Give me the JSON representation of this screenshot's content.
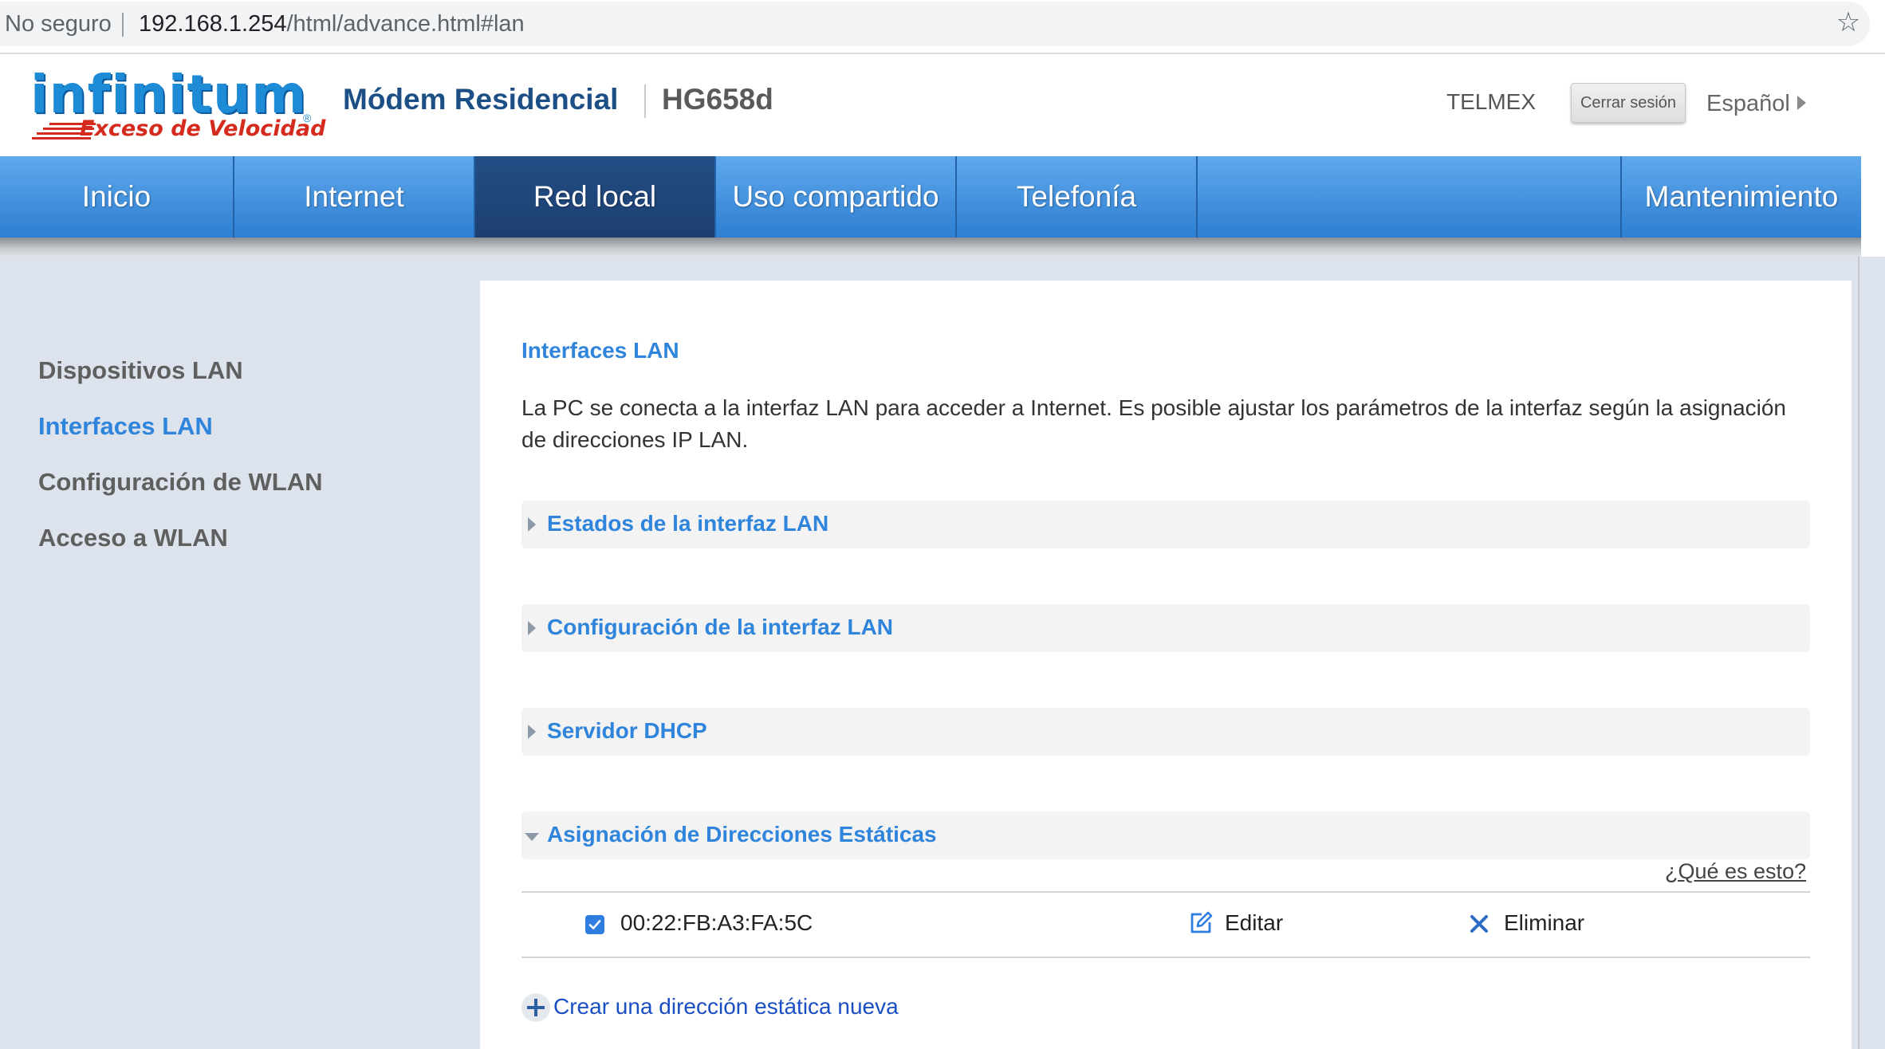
{
  "browser": {
    "security_label": "No seguro",
    "url_host": "192.168.1.254",
    "url_path": "/html/advance.html#lan",
    "bookmark_icon": "star-icon"
  },
  "header": {
    "logo_text": "infinitum",
    "logo_tagline": "Exceso de Velocidad",
    "product_title": "Módem Residencial",
    "model": "HG658d",
    "operator": "TELMEX",
    "logout_label": "Cerrar sesión",
    "language_label": "Español"
  },
  "nav": {
    "items": [
      {
        "label": "Inicio"
      },
      {
        "label": "Internet"
      },
      {
        "label": "Red local"
      },
      {
        "label": "Uso compartido"
      },
      {
        "label": "Telefonía"
      },
      {
        "label": "Mantenimiento"
      }
    ],
    "active": "Red local"
  },
  "sidebar": {
    "items": [
      {
        "label": "Dispositivos LAN"
      },
      {
        "label": "Interfaces LAN"
      },
      {
        "label": "Configuración de WLAN"
      },
      {
        "label": "Acceso a WLAN"
      }
    ],
    "active": "Interfaces LAN"
  },
  "content": {
    "title": "Interfaces LAN",
    "description": "La PC se conecta a la interfaz LAN para acceder a Internet. Es posible ajustar los parámetros de la interfaz según la asignación de direcciones IP LAN.",
    "sections": [
      {
        "label": "Estados de la interfaz LAN",
        "expanded": false
      },
      {
        "label": "Configuración de la interfaz LAN",
        "expanded": false
      },
      {
        "label": "Servidor DHCP",
        "expanded": false
      },
      {
        "label": "Asignación de Direcciones Estáticas",
        "expanded": true
      }
    ],
    "help_link": "¿Qué es esto?",
    "static_table": {
      "rows": [
        {
          "checked": true,
          "mac": "00:22:FB:A3:FA:5C",
          "edit_label": "Editar",
          "delete_label": "Eliminar"
        }
      ]
    },
    "add_label": "Crear una dirección estática nueva"
  },
  "colors": {
    "accent": "#2f84db",
    "nav_blue": "#3f92df",
    "nav_active": "#1f4678",
    "brand_red": "#d52b1e"
  }
}
